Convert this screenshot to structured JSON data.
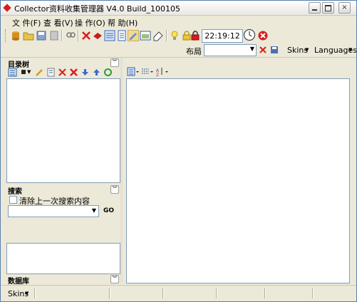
{
  "window": {
    "title": "Collector资料收集管理器 V4.0 Build_100105",
    "min_glyph": "",
    "max_glyph": "",
    "close_glyph": "×"
  },
  "menu": [
    {
      "label": "文 件(F)"
    },
    {
      "label": "查 看(V)"
    },
    {
      "label": "操 作(O)"
    },
    {
      "label": "帮 助(H)"
    }
  ],
  "toolbar": {
    "clock": "22:19:12"
  },
  "layout_bar": {
    "layout_label": "布局",
    "layout_value": "",
    "skins_label": "Skins",
    "languages_label": "Languages"
  },
  "panels": {
    "tree": {
      "title": "目录树"
    },
    "search": {
      "title": "搜索",
      "clear_previous_label": "清除上一次搜索内容",
      "query_value": "",
      "go_label": "GO"
    },
    "database": {
      "title": "数据库"
    }
  },
  "status": {
    "skins_label": "Skins"
  },
  "icon_names": [
    "open-database-icon",
    "open-folder-icon",
    "save-icon",
    "delete-db-icon",
    "search-files-icon",
    "delete-icon",
    "red-book-icon",
    "view-list-icon",
    "view-details-icon",
    "edit-icon",
    "preview-icon",
    "eraser-icon",
    "tip-bulb-icon",
    "lock-icon",
    "lock-red-icon",
    "clock-icon",
    "exit-icon"
  ],
  "colors": {
    "accent_red": "#d61e1e",
    "panel_border": "#7f9db9",
    "chrome": "#ece9d8"
  }
}
